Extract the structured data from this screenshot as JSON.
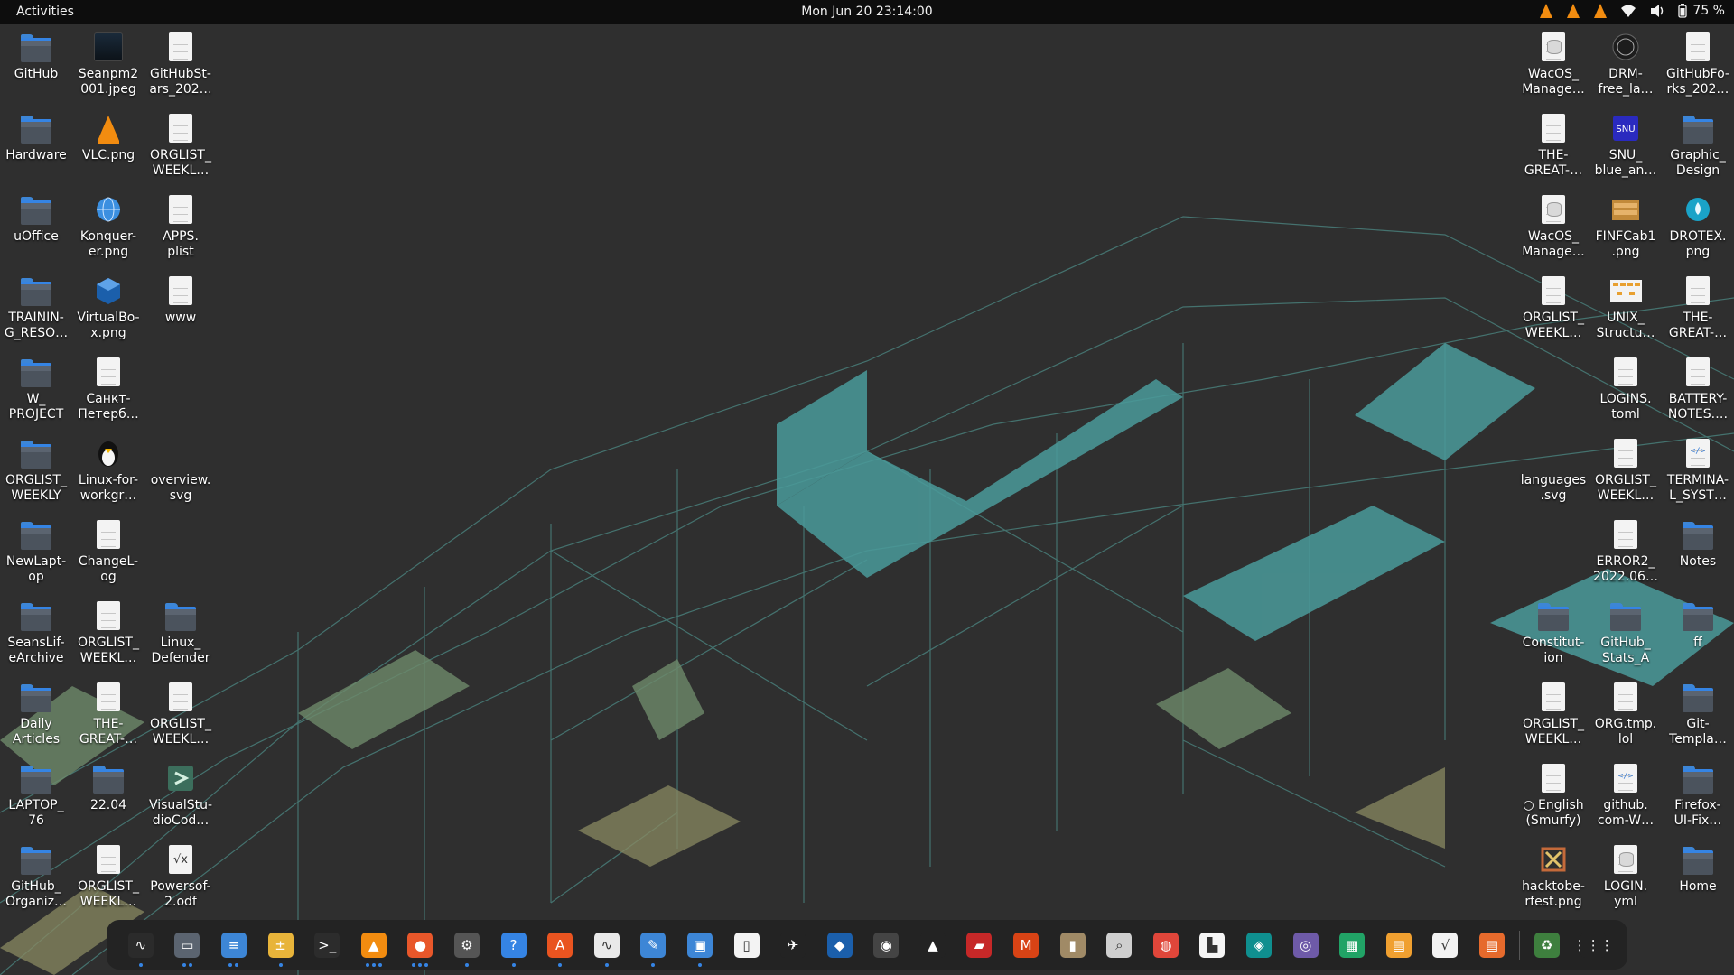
{
  "topbar": {
    "activities": "Activities",
    "clock": "Mon Jun 20  23:14:00",
    "battery_percent": "75 %",
    "tray_icons": [
      "vlc-icon",
      "vlc-icon",
      "vlc-icon",
      "wifi-icon",
      "volume-icon",
      "battery-icon"
    ]
  },
  "desktop_left": [
    {
      "label": "GitHub",
      "icon": "folder"
    },
    {
      "label": "Seanpm2\n001.jpeg",
      "icon": "image"
    },
    {
      "label": "GitHubSt-\nars_202…",
      "icon": "doc"
    },
    {
      "label": "Hardware",
      "icon": "folder"
    },
    {
      "label": "VLC.png",
      "icon": "vlc"
    },
    {
      "label": "ORGLIST_\nWEEKL…",
      "icon": "doc"
    },
    {
      "label": "uOffice",
      "icon": "folder"
    },
    {
      "label": "Konquer-\ner.png",
      "icon": "globe"
    },
    {
      "label": "APPS.\nplist",
      "icon": "doc"
    },
    {
      "label": "TRAININ-\nG_RESO…",
      "icon": "folder"
    },
    {
      "label": "VirtualBo-\nx.png",
      "icon": "vbox"
    },
    {
      "label": "www",
      "icon": "doc"
    },
    {
      "label": "W_\nPROJECT",
      "icon": "folder"
    },
    {
      "label": "Санкт-\nПетерб…",
      "icon": "doc"
    },
    {
      "label": "ORGLIST_\nWEEKLY",
      "icon": "folder"
    },
    {
      "label": "Linux-for-\nworkgr…",
      "icon": "tux"
    },
    {
      "label": "overview.\nsvg",
      "icon": "none"
    },
    {
      "label": "NewLapt-\nop",
      "icon": "folder"
    },
    {
      "label": "ChangeL-\nog",
      "icon": "doc"
    },
    {
      "label": "SeansLif-\neArchive",
      "icon": "folder"
    },
    {
      "label": "ORGLIST_\nWEEKL…",
      "icon": "doc"
    },
    {
      "label": "Linux_\nDefender",
      "icon": "folder"
    },
    {
      "label": "Daily\nArticles",
      "icon": "folder"
    },
    {
      "label": "THE-\nGREAT-…",
      "icon": "doc"
    },
    {
      "label": "ORGLIST_\nWEEKL…",
      "icon": "doc"
    },
    {
      "label": "LAPTOP_\n76",
      "icon": "folder"
    },
    {
      "label": "22.04",
      "icon": "folder"
    },
    {
      "label": "VisualStu-\ndioCod…",
      "icon": "vscode"
    },
    {
      "label": "GitHub_\nOrganiz…",
      "icon": "folder"
    },
    {
      "label": "ORGLIST_\nWEEKL…",
      "icon": "doc"
    },
    {
      "label": "Powersof-\n2.odf",
      "icon": "formula"
    }
  ],
  "desktop_right": [
    {
      "label": "WacOS_\nManage…",
      "icon": "db"
    },
    {
      "label": "DRM-\nfree_la…",
      "icon": "badge"
    },
    {
      "label": "GitHubFo-\nrks_202…",
      "icon": "doc"
    },
    {
      "label": "THE-\nGREAT-…",
      "icon": "doc"
    },
    {
      "label": "SNU_\nblue_an…",
      "icon": "snu"
    },
    {
      "label": "Graphic_\nDesign",
      "icon": "folder"
    },
    {
      "label": "WacOS_\nManage…",
      "icon": "db"
    },
    {
      "label": "FINFCab1\n.png",
      "icon": "finf"
    },
    {
      "label": "DROTEX.\npng",
      "icon": "drop"
    },
    {
      "label": "ORGLIST_\nWEEKL…",
      "icon": "doc"
    },
    {
      "label": "UNIX_\nStructu…",
      "icon": "unix"
    },
    {
      "label": "THE-\nGREAT-…",
      "icon": "doc"
    },
    {
      "label": "LOGINS.\ntoml",
      "icon": "doc"
    },
    {
      "label": "BATTERY-\nNOTES.…",
      "icon": "doc"
    },
    {
      "label": "languages\n.svg",
      "icon": "none"
    },
    {
      "label": "ORGLIST_\nWEEKL…",
      "icon": "doc"
    },
    {
      "label": "TERMINA-\nL_SYST…",
      "icon": "svgdoc"
    },
    {
      "label": "ERROR2_\n2022.06…",
      "icon": "doc"
    },
    {
      "label": "Notes",
      "icon": "folder"
    },
    {
      "label": "Constitut-\nion",
      "icon": "folder"
    },
    {
      "label": "GitHub_\nStats_A",
      "icon": "folder"
    },
    {
      "label": "ff",
      "icon": "folder"
    },
    {
      "label": "ORGLIST_\nWEEKL…",
      "icon": "doc"
    },
    {
      "label": "ORG.tmp.\nlol",
      "icon": "doc"
    },
    {
      "label": "Git-\nTempla…",
      "icon": "folder"
    },
    {
      "label": "○ English\n(Smurfy)",
      "icon": "doc"
    },
    {
      "label": "github.\ncom-W…",
      "icon": "svgdoc"
    },
    {
      "label": "Firefox-\nUI-Fix…",
      "icon": "folder"
    },
    {
      "label": "hacktobe-\nrfest.png",
      "icon": "hack"
    },
    {
      "label": "LOGIN.\nyml",
      "icon": "db"
    },
    {
      "label": "Home",
      "icon": "home"
    }
  ],
  "dock": [
    {
      "name": "system-monitor",
      "glyph": "∿",
      "color": "#2b2b2b",
      "running": 1
    },
    {
      "name": "files",
      "glyph": "▭",
      "color": "#5b6470",
      "running": 2
    },
    {
      "name": "text-editor",
      "glyph": "≡",
      "color": "#3d86d6",
      "running": 2
    },
    {
      "name": "calculator",
      "glyph": "±",
      "color": "#e8b43a",
      "running": 1
    },
    {
      "name": "terminal",
      "glyph": ">_",
      "color": "#2c2c2c",
      "running": 0
    },
    {
      "name": "vlc",
      "glyph": "▲",
      "color": "#f28c10",
      "running": 3
    },
    {
      "name": "firefox",
      "glyph": "●",
      "color": "#e8572a",
      "running": 3
    },
    {
      "name": "settings",
      "glyph": "⚙",
      "color": "#555555",
      "running": 1
    },
    {
      "name": "help",
      "glyph": "?",
      "color": "#3584e4",
      "running": 1
    },
    {
      "name": "software",
      "glyph": "A",
      "color": "#e95420",
      "running": 1
    },
    {
      "name": "graph",
      "glyph": "∿",
      "color": "#e9e9e9",
      "running": 1
    },
    {
      "name": "notes",
      "glyph": "✎",
      "color": "#3d86d6",
      "running": 1
    },
    {
      "name": "dialog",
      "glyph": "▣",
      "color": "#3d86d6",
      "running": 1
    },
    {
      "name": "blank-doc",
      "glyph": "▯",
      "color": "#f3f3f3",
      "running": 0
    },
    {
      "name": "bird",
      "glyph": "✈",
      "color": "#232323",
      "running": 0
    },
    {
      "name": "virtualbox",
      "glyph": "◆",
      "color": "#1b5fab",
      "running": 0
    },
    {
      "name": "camera",
      "glyph": "◉",
      "color": "#444444",
      "running": 0
    },
    {
      "name": "mountain",
      "glyph": "▲",
      "color": "#232323",
      "running": 0
    },
    {
      "name": "racer",
      "glyph": "▰",
      "color": "#c62828",
      "running": 0
    },
    {
      "name": "mario",
      "glyph": "M",
      "color": "#d84315",
      "running": 0
    },
    {
      "name": "archive",
      "glyph": "▮",
      "color": "#a08a66",
      "running": 0
    },
    {
      "name": "image-viewer",
      "glyph": "⌕",
      "color": "#cfcfcf",
      "running": 0
    },
    {
      "name": "chrome",
      "glyph": "◍",
      "color": "#e0463a",
      "running": 0
    },
    {
      "name": "books",
      "glyph": "▙",
      "color": "#f5f5f5",
      "running": 0
    },
    {
      "name": "teal-app",
      "glyph": "◈",
      "color": "#0f8f8f",
      "running": 0
    },
    {
      "name": "screenshot",
      "glyph": "◎",
      "color": "#6e5aa8",
      "running": 0
    },
    {
      "name": "calc-sheet",
      "glyph": "▦",
      "color": "#21a366",
      "running": 0
    },
    {
      "name": "impress",
      "glyph": "▤",
      "color": "#f0a030",
      "running": 0
    },
    {
      "name": "math",
      "glyph": "√",
      "color": "#f3f3f3",
      "running": 0
    },
    {
      "name": "present",
      "glyph": "▤",
      "color": "#e66a2c",
      "running": 0
    },
    {
      "name": "trash",
      "glyph": "♻",
      "color": "#3e7f3e",
      "running": 0
    },
    {
      "name": "show-apps",
      "glyph": "⋮⋮⋮",
      "color": "#232323",
      "running": 0
    }
  ]
}
